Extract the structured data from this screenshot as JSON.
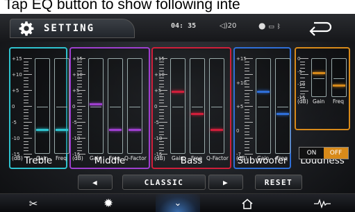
{
  "caption": "Tap EQ button to show following inte",
  "header": {
    "title": "SETTING",
    "clock": "04: 35",
    "volume": "20",
    "back_icon": "return-arrow-icon",
    "settings_icon": "gear-icon"
  },
  "colors": {
    "treble": "#2fc3cf",
    "middle": "#9f3fd0",
    "bass": "#d01e3a",
    "subwoofer": "#2f6fd8",
    "loudness": "#d88a1a"
  },
  "eq": {
    "scale_labels": [
      "+15",
      "+10",
      "+5",
      "0",
      "-5",
      "-10",
      "-15"
    ],
    "db_unit": "(dB)",
    "bands": [
      {
        "name": "Treble",
        "sliders": [
          {
            "label": "Gain",
            "value": -7
          },
          {
            "label": "Freq",
            "value": -7
          }
        ]
      },
      {
        "name": "Middle",
        "sliders": [
          {
            "label": "Gain",
            "value": 1
          },
          {
            "label": "Freq",
            "value": -7
          },
          {
            "label": "Q-Factor",
            "value": -7
          }
        ]
      },
      {
        "name": "Bass",
        "sliders": [
          {
            "label": "Gain",
            "value": 5
          },
          {
            "label": "Freq",
            "value": -2
          },
          {
            "label": "Q-Factor",
            "value": -7
          }
        ]
      },
      {
        "name": "Subwoofer",
        "scale_labels": [
          "+15",
          "+10",
          "+5",
          "0",
          "-7"
        ],
        "sliders": [
          {
            "label": "Gain",
            "value": 5
          },
          {
            "label": "Freq",
            "value": -2
          }
        ]
      },
      {
        "name": "Loudness",
        "scale_labels": [
          "0",
          "-5",
          "-10",
          "-15"
        ],
        "sliders": [
          {
            "label": "Gain",
            "value": -5
          },
          {
            "label": "Freq",
            "value": -10
          }
        ]
      }
    ],
    "loudness_toggle": {
      "on": "ON",
      "off": "OFF",
      "selected": "OFF"
    }
  },
  "preset": {
    "prev_icon": "triangle-left-icon",
    "name": "CLASSIC",
    "next_icon": "triangle-right-icon",
    "reset": "RESET"
  },
  "navbar": {
    "items": [
      "tools-icon",
      "brightness-icon",
      "chevron-down-icon",
      "home-icon",
      "audio-wave-icon"
    ],
    "active_index": 2
  }
}
